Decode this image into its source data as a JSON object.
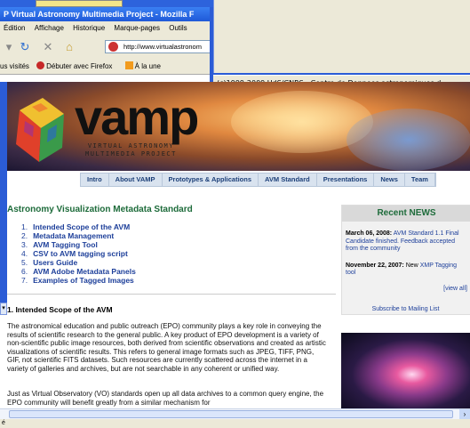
{
  "back_window": {
    "status_text": "(c)1999-2009 UdS/CNRS - Centre de Donnees astronomiques d"
  },
  "browser": {
    "title": "P Virtual Astronomy Multimedia Project - Mozilla F",
    "menu": [
      "Édition",
      "Affichage",
      "Historique",
      "Marque-pages",
      "Outils"
    ],
    "url": "http://www.virtualastronom",
    "bookmarks": [
      "us visités",
      "Débuter avec Firefox",
      "À la une"
    ]
  },
  "banner": {
    "logo": "vamp",
    "subtitle_line1": "VIRTUAL ASTRONOMY",
    "subtitle_line2": "MULTIMEDIA PROJECT"
  },
  "nav_tabs": [
    "Intro",
    "About VAMP",
    "Prototypes & Applications",
    "AVM Standard",
    "Presentations",
    "News",
    "Team"
  ],
  "main": {
    "title": "Astronomy Visualization Metadata Standard",
    "toc": [
      {
        "num": "1.",
        "label": "Intended Scope of the AVM"
      },
      {
        "num": "2.",
        "label": "Metadata Management"
      },
      {
        "num": "3.",
        "label": "AVM Tagging Tool"
      },
      {
        "num": "4.",
        "label": "CSV to AVM tagging script"
      },
      {
        "num": "5.",
        "label": "Users Guide"
      },
      {
        "num": "6.",
        "label": "AVM Adobe Metadata Panels"
      },
      {
        "num": "7.",
        "label": "Examples of Tagged Images"
      }
    ],
    "section_title": "1. Intended Scope of the AVM",
    "para1": "The astronomical education and public outreach (EPO) community plays a key role in conveying the results of scientific research to the general public. A key product of EPO development is a variety of non-scientific public image resources, both derived from scientific observations and created as artistic visualizations of scientific results. This refers to general image formats such as JPEG, TIFF, PNG, GIF, not scientific FITS datasets. Such resources are currently scattered across the internet in a variety of galleries and archives, but are not searchable in any coherent or unified way.",
    "para2": "Just as Virtual Observatory (VO) standards open up all data archives to a common query engine, the EPO community will benefit greatly from a similar mechanism for"
  },
  "sidebar": {
    "heading": "Recent NEWS",
    "news": [
      {
        "date": "March 06, 2008:",
        "text": "AVM Standard 1.1 Final Candidate finished. Feedback accepted from the community"
      },
      {
        "date": "November 22, 2007:",
        "text_plain": "New",
        "text": "XMP Tagging tool"
      }
    ],
    "view_all": "[view all]",
    "subscribe": "Subscribe to Mailing List"
  },
  "statusbar": {
    "text": "é"
  }
}
